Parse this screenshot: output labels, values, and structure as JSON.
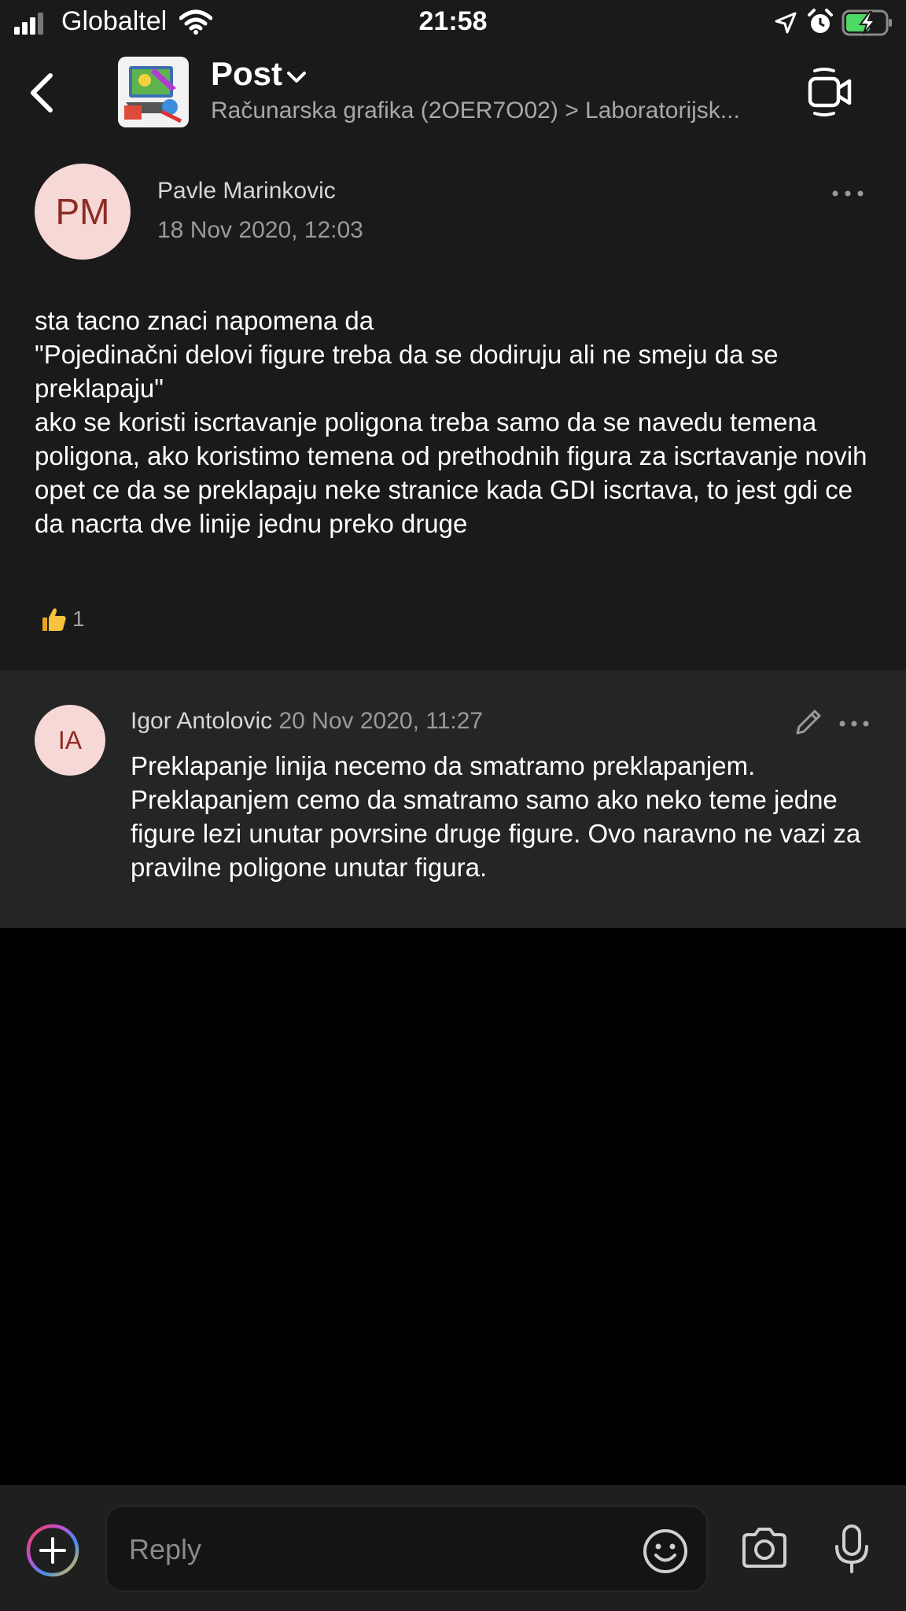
{
  "status_bar": {
    "carrier": "Globaltel",
    "time": "21:58"
  },
  "header": {
    "title": "Post",
    "breadcrumb": "Računarska grafika (2OER7O02) > Laboratorijsk..."
  },
  "post": {
    "avatar_initials": "PM",
    "author": "Pavle Marinkovic",
    "date": "18 Nov 2020, 12:03",
    "body": "sta tacno znaci napomena da\n\"Pojedinačni delovi figure treba da se dodiruju ali ne smeju da se preklapaju\"\nako se koristi iscrtavanje poligona treba samo da se navedu temena poligona, ako koristimo temena od prethodnih figura za iscrtavanje novih opet ce da se preklapaju neke stranice kada GDI iscrtava, to jest gdi ce da nacrta dve linije jednu preko druge",
    "reaction_count": "1"
  },
  "reply": {
    "avatar_initials": "IA",
    "author": "Igor Antolovic",
    "date": "20 Nov 2020, 11:27",
    "body": "Preklapanje linija necemo da smatramo preklapanjem. Preklapanjem cemo da smatramo samo ako neko teme jedne figure lezi unutar povrsine druge figure. Ovo naravno ne vazi za pravilne poligone unutar figura."
  },
  "composer": {
    "placeholder": "Reply"
  },
  "icons": {
    "back": "chevron-left-icon",
    "title_dropdown": "chevron-down-icon",
    "meet": "video-call-icon",
    "more": "more-horizontal-icon",
    "edit": "pencil-icon",
    "reaction": "thumbs-up-icon",
    "add": "plus-circle-icon",
    "emoji": "emoji-icon",
    "camera": "camera-icon",
    "mic": "microphone-icon"
  },
  "colors": {
    "background": "#000000",
    "header_bg": "#1a1a1a",
    "reply_bg": "#252525",
    "avatar_bg": "#f6d8d6",
    "avatar_text": "#8c2d22",
    "battery_green": "#4cd964"
  }
}
